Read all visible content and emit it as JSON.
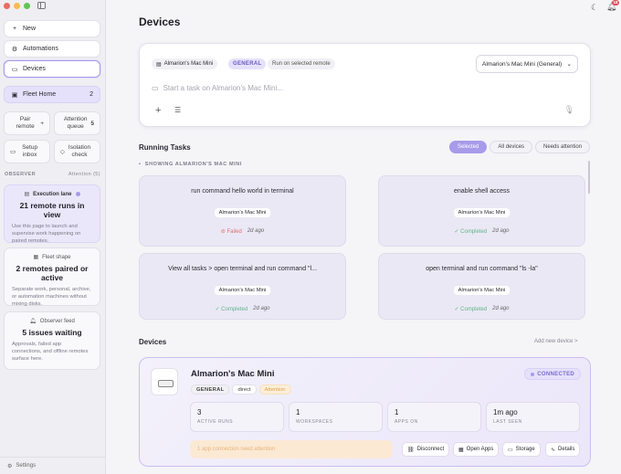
{
  "sidebar": {
    "new_label": "New",
    "automations_label": "Automations",
    "devices_label": "Devices",
    "fleet_home_label": "Fleet Home",
    "fleet_home_count": "2",
    "pair_remote_label": "Pair remote",
    "attention_queue_label": "Attention queue",
    "attention_queue_count": "5",
    "setup_inbox_label": "Setup inbox",
    "isolation_check_label": "Isolation check",
    "observer_label": "OBSERVER",
    "observer_attention": "Attention (5)",
    "exec_lane": {
      "title": "Execution lane",
      "value": "21 remote runs in view",
      "desc": "Use this page to launch and supervise work happening on paired remotes."
    },
    "fleet_shape": {
      "title": "Fleet shape",
      "value": "2 remotes paired or active",
      "desc": "Separate work, personal, archive, or automation machines without mixing disks."
    },
    "observer_feed": {
      "title": "Observer feed",
      "value": "5 issues waiting",
      "desc": "Approvals, failed app connections, and offline remotes surface here."
    },
    "settings_label": "Settings"
  },
  "header": {
    "title": "Devices",
    "notif_count": "18"
  },
  "composer": {
    "device_chip": "Almarion's Mac Mini",
    "general_chip": "GENERAL",
    "run_chip": "Run on selected remote",
    "select_value": "Almarion's Mac Mini (General)",
    "placeholder": "Start a task on Almarion's Mac Mini..."
  },
  "running_tasks": {
    "title": "Running Tasks",
    "filters": [
      "Selected",
      "All devices",
      "Needs attention"
    ],
    "showing_label": "SHOWING ALMARION'S MAC MINI",
    "tasks": [
      {
        "title": "run command hello world in terminal",
        "device": "Almarion's Mac Mini",
        "status": "Failed",
        "ago": "2d ago"
      },
      {
        "title": "enable shell access",
        "device": "Almarion's Mac Mini",
        "status": "Completed",
        "ago": "2d ago"
      },
      {
        "title": "View all tasks > open terminal and run command \"l...",
        "device": "Almarion's Mac Mini",
        "status": "Completed",
        "ago": "2d ago"
      },
      {
        "title": "open terminal and run command \"ls -la\"",
        "device": "Almarion's Mac Mini",
        "status": "Completed",
        "ago": "2d ago"
      }
    ]
  },
  "devices": {
    "title": "Devices",
    "add_label": "Add new device >",
    "card": {
      "name": "Almarion's Mac Mini",
      "tags": [
        "GENERAL",
        "direct",
        "Attention"
      ],
      "status": "CONNECTED",
      "stats": [
        {
          "value": "3",
          "label": "ACTIVE RUNS"
        },
        {
          "value": "1",
          "label": "WORKSPACES"
        },
        {
          "value": "1",
          "label": "APPS ON"
        },
        {
          "value": "1m ago",
          "label": "LAST SEEN"
        }
      ],
      "warning": "1 app connection need attention",
      "actions": [
        "Disconnect",
        "Open Apps",
        "Storage",
        "Details"
      ]
    }
  }
}
